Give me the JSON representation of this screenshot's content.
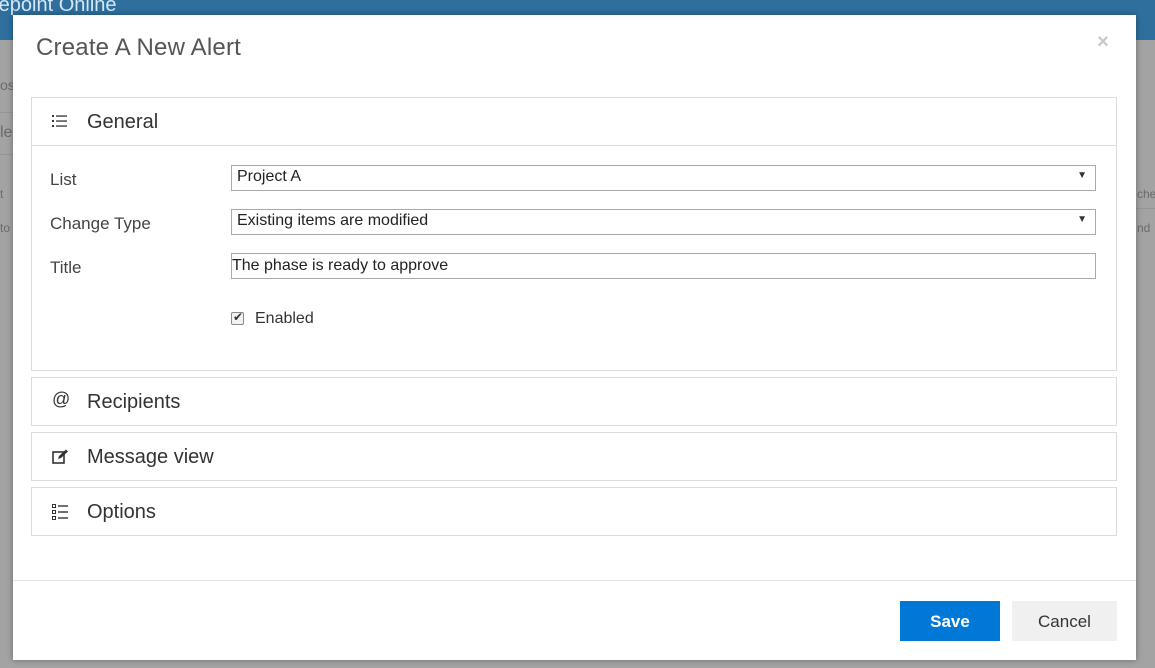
{
  "background": {
    "app_title": "repoint Online",
    "fragments": [
      "os",
      "le",
      "t",
      "to",
      "che",
      "nd"
    ]
  },
  "modal": {
    "title": "Create A New Alert",
    "close_icon": "×"
  },
  "sections": {
    "general": {
      "icon": "list-icon",
      "label": "General",
      "fields": {
        "list": {
          "label": "List",
          "value": "Project A"
        },
        "change_type": {
          "label": "Change Type",
          "value": "Existing items are modified"
        },
        "title": {
          "label": "Title",
          "value": "The phase is ready to approve"
        },
        "enabled": {
          "label": "Enabled",
          "checked": true
        }
      }
    },
    "recipients": {
      "icon": "at-icon",
      "label": "Recipients"
    },
    "message_view": {
      "icon": "edit-icon",
      "label": "Message view"
    },
    "options": {
      "icon": "checklist-icon",
      "label": "Options"
    }
  },
  "footer": {
    "save_label": "Save",
    "cancel_label": "Cancel"
  },
  "colors": {
    "primary": "#0078d7",
    "header_bar": "#2e6f9e"
  }
}
